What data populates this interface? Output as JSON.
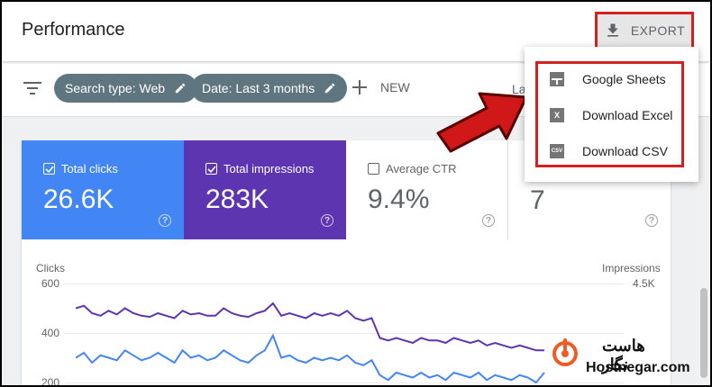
{
  "header": {
    "title": "Performance",
    "export_label": "EXPORT"
  },
  "filters": {
    "chips": [
      {
        "label": "Search type: Web"
      },
      {
        "label": "Date: Last 3 months"
      }
    ],
    "new_label": "NEW",
    "last_label": "La"
  },
  "export_menu": {
    "items": [
      {
        "label": "Google Sheets",
        "icon": "sheets-icon"
      },
      {
        "label": "Download Excel",
        "icon": "excel-icon",
        "icon_text": "X"
      },
      {
        "label": "Download CSV",
        "icon": "csv-icon",
        "icon_text": "CSV"
      }
    ]
  },
  "metrics": [
    {
      "label": "Total clicks",
      "value": "26.6K",
      "checked": true,
      "color": "#4285f4"
    },
    {
      "label": "Total impressions",
      "value": "283K",
      "checked": true,
      "color": "#5e35b1"
    },
    {
      "label": "Average CTR",
      "value": "9.4%",
      "checked": false
    },
    {
      "label": "",
      "value": "7",
      "checked": false
    }
  ],
  "chart_data": {
    "type": "line",
    "left_axis_label": "Clicks",
    "right_axis_label": "Impressions",
    "left_ticks": [
      "600",
      "400",
      "200"
    ],
    "right_ticks": [
      "4.5K"
    ],
    "ylim_left": [
      200,
      600
    ],
    "series": [
      {
        "name": "Impressions",
        "color": "#5e35b1",
        "values": [
          500,
          510,
          480,
          470,
          490,
          475,
          500,
          480,
          470,
          465,
          480,
          470,
          460,
          490,
          475,
          480,
          470,
          470,
          500,
          480,
          470,
          465,
          480,
          490,
          520,
          470,
          480,
          470,
          460,
          480,
          470,
          480,
          470,
          490,
          460,
          450,
          460,
          380,
          370,
          380,
          370,
          360,
          380,
          370,
          370,
          360,
          380,
          370,
          360,
          370,
          350,
          360,
          350,
          340,
          350,
          340,
          330,
          330
        ]
      },
      {
        "name": "Clicks",
        "color": "#4285f4",
        "values": [
          300,
          320,
          280,
          310,
          300,
          290,
          330,
          310,
          290,
          300,
          320,
          300,
          280,
          330,
          300,
          310,
          290,
          300,
          330,
          310,
          290,
          280,
          310,
          330,
          390,
          300,
          310,
          290,
          280,
          300,
          290,
          300,
          290,
          310,
          280,
          270,
          290,
          230,
          210,
          240,
          230,
          220,
          240,
          220,
          230,
          210,
          240,
          230,
          220,
          240,
          210,
          230,
          220,
          210,
          230,
          220,
          200,
          240
        ]
      }
    ]
  },
  "brand": {
    "name_fa": "هاست نگار",
    "domain": "Hostnegar.com",
    "logo_color": "#f15a22"
  }
}
